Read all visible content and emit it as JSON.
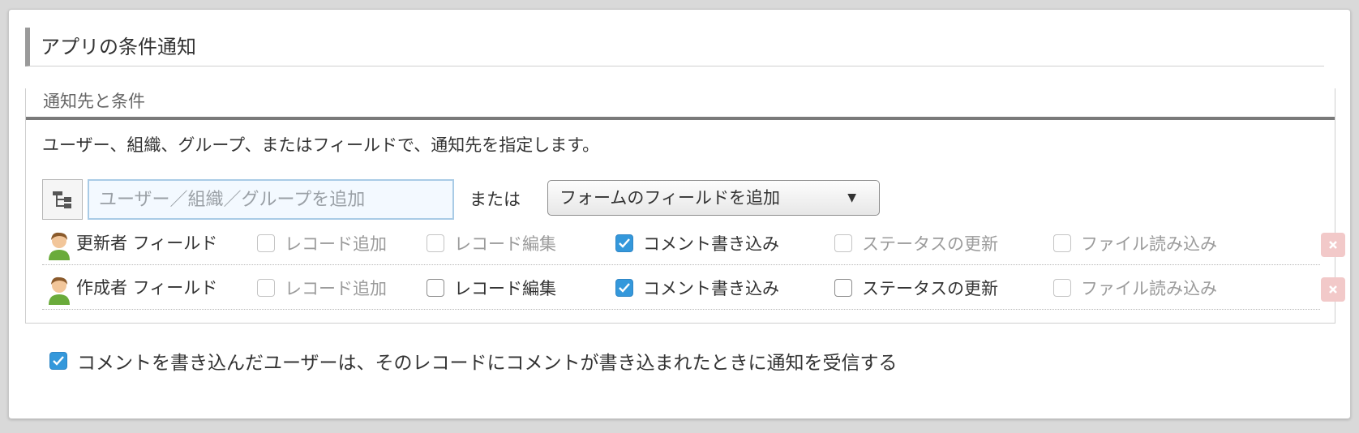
{
  "title": "アプリの条件通知",
  "section": {
    "header": "通知先と条件",
    "description": "ユーザー、組織、グループ、またはフィールドで、通知先を指定します。",
    "search_placeholder": "ユーザー／組織／グループを追加",
    "or_text": "または",
    "field_select_label": "フォームのフィールドを追加",
    "rows": [
      {
        "field_name": "更新者 フィールド",
        "options": [
          {
            "label": "レコード追加",
            "checked": false,
            "enabled": false
          },
          {
            "label": "レコード編集",
            "checked": false,
            "enabled": false
          },
          {
            "label": "コメント書き込み",
            "checked": true,
            "enabled": true
          },
          {
            "label": "ステータスの更新",
            "checked": false,
            "enabled": false
          },
          {
            "label": "ファイル読み込み",
            "checked": false,
            "enabled": false
          }
        ]
      },
      {
        "field_name": "作成者 フィールド",
        "options": [
          {
            "label": "レコード追加",
            "checked": false,
            "enabled": false
          },
          {
            "label": "レコード編集",
            "checked": false,
            "enabled": true
          },
          {
            "label": "コメント書き込み",
            "checked": true,
            "enabled": true
          },
          {
            "label": "ステータスの更新",
            "checked": false,
            "enabled": true
          },
          {
            "label": "ファイル読み込み",
            "checked": false,
            "enabled": false
          }
        ]
      }
    ]
  },
  "bottom_option": {
    "label": "コメントを書き込んだユーザーは、そのレコードにコメントが書き込まれたときに通知を受信する",
    "checked": true
  },
  "colors": {
    "accent": "#3498db",
    "delete": "#f2c9c9"
  },
  "icons": {
    "picker": "org-tree-icon",
    "row": "user-avatar-icon",
    "delete": "close-icon",
    "dropdown": "caret-down-icon"
  }
}
